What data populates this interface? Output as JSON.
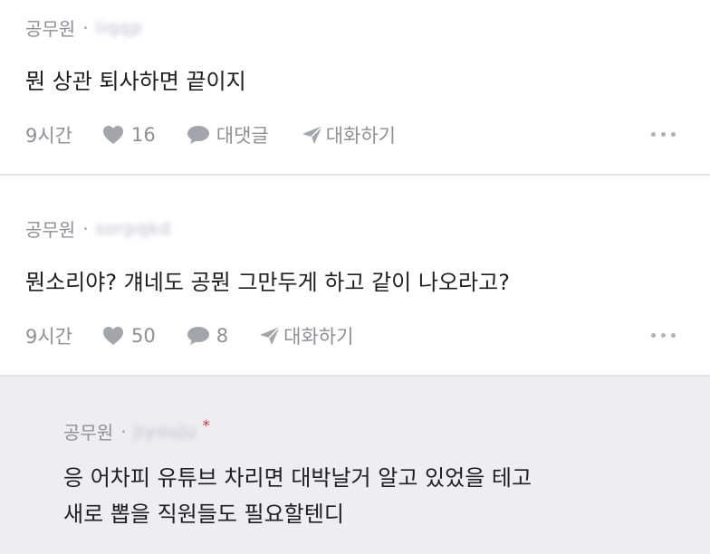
{
  "comments": [
    {
      "author": "공무원",
      "separator": "·",
      "masked_handle": "liqqp",
      "text": "뭔 상관 퇴사하면 끝이지",
      "time": "9시간",
      "likes": "16",
      "reply_label": "대댓글",
      "dm_label": "대화하기"
    },
    {
      "author": "공무원",
      "separator": "·",
      "masked_handle": "sorpqkd",
      "text": "뭔소리야? 걔네도 공뭔 그만두게 하고 같이 나오라고?",
      "time": "9시간",
      "likes": "50",
      "replies": "8",
      "dm_label": "대화하기"
    },
    {
      "author": "공무원",
      "separator": "·",
      "masked_handle": "jiyouju",
      "author_marker": "*",
      "text_line1": "응 어차피 유튜브 차리면 대박날거 알고 있었을 테고",
      "text_line2": "새로 뽑을 직원들도 필요할텐디"
    }
  ],
  "icons": {
    "like": "heart-icon",
    "reply": "speech-bubble-icon",
    "dm": "paper-plane-icon",
    "more": "more-horizontal-icon"
  },
  "colors": {
    "meta_text": "#8f8f96",
    "reply_background": "#eeeef1",
    "author_marker": "#d23a3a"
  }
}
